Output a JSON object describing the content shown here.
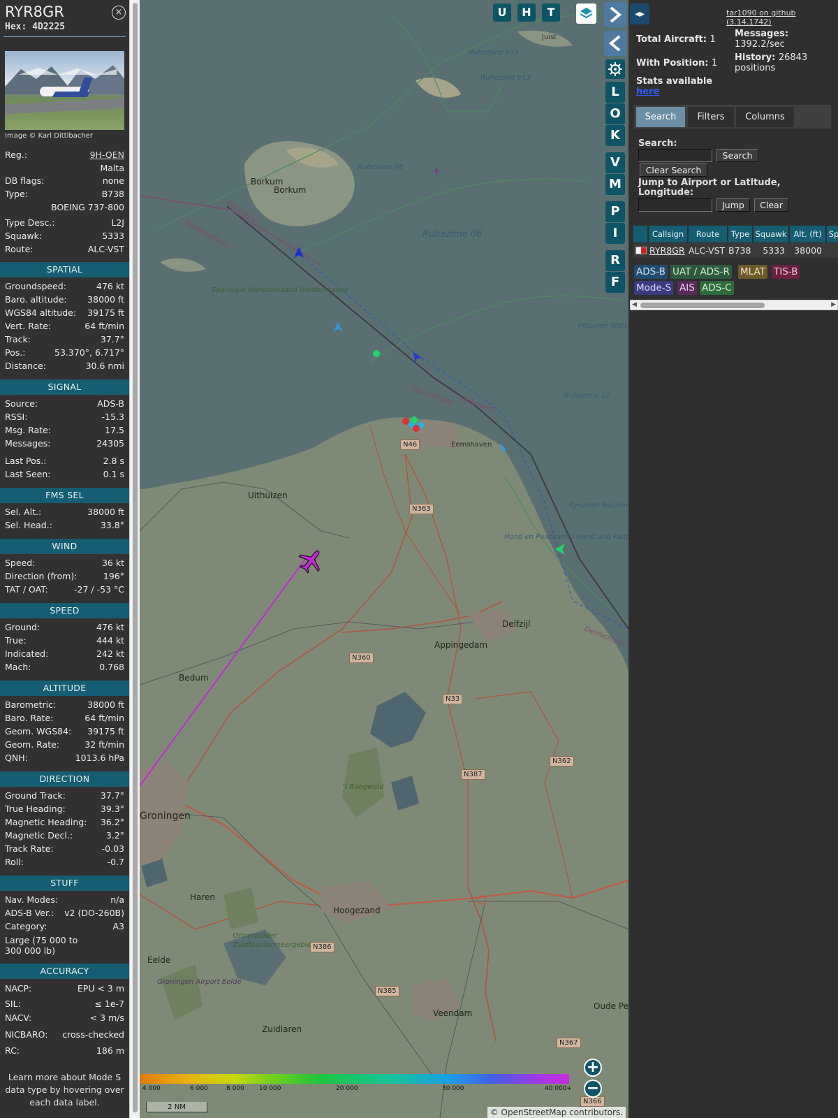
{
  "info": {
    "callsign": "RYR8GR",
    "hex": "Hex: 4D2225",
    "close_icon": "×",
    "photo_credit": "Image © Karl Dittlbacher",
    "reg_label": "Reg.:",
    "reg_value": "9H-QEN",
    "country": "Malta",
    "dbflags_label": "DB flags:",
    "dbflags_value": "none",
    "type_label": "Type:",
    "type_value": "B738",
    "type_full": "BOEING 737-800",
    "typedesc_label": "Type Desc.:",
    "typedesc_value": "L2J",
    "squawk_label": "Squawk:",
    "squawk_value": "5333",
    "route_label": "Route:",
    "route_value": "ALC-VST",
    "sections": {
      "spatial": "SPATIAL",
      "signal": "SIGNAL",
      "fms": "FMS SEL",
      "wind": "WIND",
      "speed": "SPEED",
      "altitude": "ALTITUDE",
      "direction": "DIRECTION",
      "stuff": "STUFF",
      "accuracy": "ACCURACY"
    },
    "spatial": [
      {
        "k": "Groundspeed:",
        "v": "476 kt"
      },
      {
        "k": "Baro. altitude:",
        "v": "38000 ft"
      },
      {
        "k": "WGS84 altitude:",
        "v": "39175 ft"
      },
      {
        "k": "Vert. Rate:",
        "v": "64 ft/min"
      },
      {
        "k": "Track:",
        "v": "37.7°"
      },
      {
        "k": "Pos.:",
        "v": "53.370°, 6.717°"
      },
      {
        "k": "Distance:",
        "v": "30.6 nmi"
      }
    ],
    "signal": [
      {
        "k": "Source:",
        "v": "ADS-B"
      },
      {
        "k": "RSSI:",
        "v": "-15.3"
      },
      {
        "k": "Msg. Rate:",
        "v": "17.5"
      },
      {
        "k": "Messages:",
        "v": "24305"
      },
      {
        "k": "Last Pos.:",
        "v": "2.8 s"
      },
      {
        "k": "Last Seen:",
        "v": "0.1 s"
      }
    ],
    "fms": [
      {
        "k": "Sel. Alt.:",
        "v": "38000 ft"
      },
      {
        "k": "Sel. Head.:",
        "v": "33.8°"
      }
    ],
    "wind": [
      {
        "k": "Speed:",
        "v": "36 kt"
      },
      {
        "k": "Direction (from):",
        "v": "196°"
      },
      {
        "k": "TAT / OAT:",
        "v": "-27 / -53 °C"
      }
    ],
    "speed": [
      {
        "k": "Ground:",
        "v": "476 kt"
      },
      {
        "k": "True:",
        "v": "444 kt"
      },
      {
        "k": "Indicated:",
        "v": "242 kt"
      },
      {
        "k": "Mach:",
        "v": "0.768"
      }
    ],
    "altitude": [
      {
        "k": "Barometric:",
        "v": "38000 ft"
      },
      {
        "k": "Baro. Rate:",
        "v": "64 ft/min"
      },
      {
        "k": "Geom. WGS84:",
        "v": "39175 ft"
      },
      {
        "k": "Geom. Rate:",
        "v": "32 ft/min"
      },
      {
        "k": "QNH:",
        "v": "1013.6 hPa"
      }
    ],
    "direction": [
      {
        "k": "Ground Track:",
        "v": "37.7°"
      },
      {
        "k": "True Heading:",
        "v": "39.3°"
      },
      {
        "k": "Magnetic Heading:",
        "v": "36.2°"
      },
      {
        "k": "Magnetic Decl.:",
        "v": "3.2°"
      },
      {
        "k": "Track Rate:",
        "v": "-0.03"
      },
      {
        "k": "Roll:",
        "v": "-0.7"
      }
    ],
    "stuff": [
      {
        "k": "Nav. Modes:",
        "v": "n/a"
      },
      {
        "k": "ADS-B Ver.:",
        "v": "v2 (DO-260B)"
      },
      {
        "k": "Category:",
        "v": "A3"
      }
    ],
    "category_desc": "Large (75 000 to 300 000 lb)",
    "accuracy": [
      {
        "k": "NACP:",
        "v": "EPU < 3 m"
      },
      {
        "k": "SIL:",
        "v": "≤ 1e-7"
      },
      {
        "k": "NACV:",
        "v": "< 3 m/s"
      },
      {
        "k": "NICBARO:",
        "v": "cross-checked"
      },
      {
        "k": "RC:",
        "v": "186 m"
      }
    ],
    "learn_more": "Learn more about Mode S data type by hovering over each data label."
  },
  "map": {
    "buttons_top": [
      "U",
      "H",
      "T"
    ],
    "buttons_side": [
      "L",
      "O",
      "K",
      "V",
      "M",
      "P",
      "I",
      "R",
      "F"
    ],
    "icons": {
      "layers": "layers-icon",
      "settings": "gear-icon",
      "expand": "chevron-right-icon",
      "collapse": "chevron-left-icon",
      "zoom_in": "plus-icon",
      "zoom_out": "minus-icon"
    },
    "places": {
      "borkum1": "Borkum",
      "borkum2": "Borkum",
      "juist": "Juist",
      "uithuizen": "Uithuizen",
      "eemshaven": "Eemshaven",
      "delfzijl": "Delfzijl",
      "appingedam": "Appingedam",
      "bedum": "Bedum",
      "groningen": "Groningen",
      "haren": "Haren",
      "hoogezand": "Hoogezand",
      "eelde": "Eelde",
      "zuidlaren": "Zuidlaren",
      "veendam": "Veendam",
      "oudepek": "Oude Pek",
      "ruhezone_i6": "Ruhezone I/6",
      "ruhezone_i13": "Ruhezone I/13",
      "ruhezone_i14": "Ruhezone I/14",
      "ruhezone_i8": "Ruhezone I/8",
      "ruhezone_i2": "Ruhezone I/2",
      "hond": "Hond en Paapzand / Hund und Paapsand",
      "pilsumer": "Pilsumer Watt",
      "rysumer": "Rysumer Nacken",
      "sparregat": "Sparregat Horsbornzand Horsbornzand",
      "roegwold": "'t Roegwold",
      "onnerpolder": "Onnerpolder",
      "zuidlaarder": "Zuidlaardermeergebied",
      "groningen_airport": "Groningen Airport Eelde",
      "nederland": "Nederland",
      "niedersachsen": "Niedersachsen",
      "deutschland1": "Deutschland",
      "nederland2": "Nederland",
      "deutschland2": "Deutschland"
    },
    "roads": [
      "N46",
      "N363",
      "N360",
      "N33",
      "N387",
      "N362",
      "N386",
      "N385",
      "N367",
      "N366"
    ],
    "alt_legend": [
      "4 000",
      "6 000",
      "8 000",
      "10 000",
      "20 000",
      "30 000",
      "40 000+"
    ],
    "scale": "2 NM",
    "attribution": "© OpenStreetMap contributors.",
    "colors": {
      "track": "#c428d8",
      "aircraft": "#c428d8",
      "water": "#5a6f72",
      "land": "#7e8a76"
    }
  },
  "right": {
    "toggle_icon": "◂▸",
    "github": "tar1090 on github (3.14.1742)",
    "total_aircraft_label": "Total Aircraft:",
    "total_aircraft": "1",
    "with_position_label": "With Position:",
    "with_position": "1",
    "messages_label": "Messages:",
    "messages_rate": "1392.2/sec",
    "history_label": "History:",
    "history_value": "26843",
    "history_unit": "positions",
    "stats_label": "Stats available",
    "stats_link": "here",
    "tabs": [
      "Search",
      "Filters",
      "Columns"
    ],
    "search_label": "Search:",
    "search_value": "",
    "search_button": "Search",
    "clear_search_button": "Clear Search",
    "jump_label": "Jump to Airport or Latitude, Longitude:",
    "jump_value": "",
    "jump_button": "Jump",
    "clear_button": "Clear",
    "table_headers": [
      "",
      "Callsign",
      "Route",
      "Type",
      "Squawk",
      "Alt. (ft)",
      "Sp"
    ],
    "table_row": {
      "callsign": "RYR8GR",
      "route": "ALC-VST",
      "type": "B738",
      "squawk": "5333",
      "alt": "38000"
    },
    "sources": [
      "ADS-B",
      "UAT / ADS-R",
      "MLAT",
      "TIS-B",
      "Mode-S",
      "AIS",
      "ADS-C"
    ],
    "scroll_left": "◀",
    "scroll_right": "▶"
  }
}
